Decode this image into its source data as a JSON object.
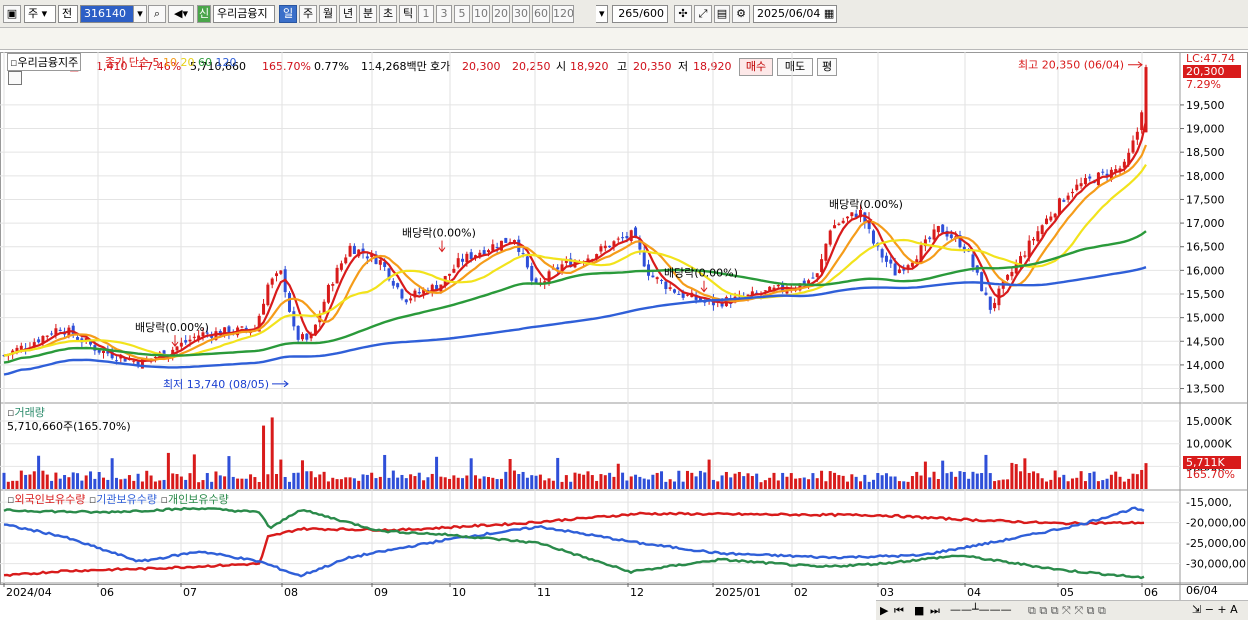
{
  "toolbar": {
    "period_type": "주",
    "compare_label": "전",
    "stock_code": "316140",
    "new_badge": "신",
    "stock_name": "우리금융지",
    "period_tabs": [
      "일",
      "주",
      "월",
      "년",
      "분",
      "초",
      "틱"
    ],
    "active_period": "일",
    "interval_buttons": [
      "1",
      "3",
      "5",
      "10",
      "20",
      "30",
      "60",
      "120"
    ],
    "count_value": "265",
    "count_max": "/600",
    "date_value": "2025/06/04"
  },
  "quote": {
    "price": "20,300",
    "change": "1,410",
    "change_pct": "+7.46%",
    "volume": "5,710,660",
    "volume_ratio": "165.70%",
    "turnover": "0.77%",
    "amount": "114,268백만",
    "hoga_label": "호가",
    "ask": "20,300",
    "bid": "20,250",
    "open_label": "시",
    "open": "18,920",
    "high_label": "고",
    "high": "20,350",
    "low_label": "저",
    "low": "18,920",
    "buy_label": "매수",
    "sell_label": "매도",
    "eval_label": "평"
  },
  "price_panel": {
    "title": "우리금융지주",
    "legend_prefix": "종가 단순",
    "ma_periods": [
      "5",
      "10",
      "20",
      "60",
      "120"
    ],
    "ma_colors": [
      "#d81b1b",
      "#f59c1a",
      "#f2e31c",
      "#2a9a3a",
      "#2f5fd8"
    ],
    "lc_label": "LC:47.74",
    "price_tag": "20,300",
    "pct_tag": "7.29%",
    "high_note": "최고 20,350 (06/04)",
    "low_note": "최저 13,740 (08/05)",
    "dividend_label": "배당락(0.00%)",
    "y_ticks": [
      "19,500",
      "19,000",
      "18,500",
      "18,000",
      "17,500",
      "17,000",
      "16,500",
      "16,000",
      "15,500",
      "15,000",
      "14,500",
      "14,000",
      "13,500"
    ]
  },
  "volume_panel": {
    "title": "거래량",
    "value_label": "5,710,660주(165.70%)",
    "y_ticks": [
      "15,000K",
      "10,000K",
      "5,000K"
    ],
    "tag_value": "5,711K",
    "tag_pct": "165.70%"
  },
  "holding_panel": {
    "series": [
      {
        "name": "외국인보유수량",
        "color": "#d81b1b"
      },
      {
        "name": "기관보유수량",
        "color": "#2f5fd8"
      },
      {
        "name": "개인보유수량",
        "color": "#2a8a4a"
      }
    ],
    "y_ticks": [
      "-15,000,",
      "-20,000,00",
      "-25,000,00",
      "-30,000,00"
    ]
  },
  "x_axis": {
    "labels": [
      "2024/04",
      "06",
      "07",
      "08",
      "09",
      "10",
      "11",
      "12",
      "2025/01",
      "02",
      "03",
      "04",
      "05",
      "06"
    ],
    "last_date": "06/04"
  },
  "chart_data": {
    "type": "candlestick",
    "title": "우리금융지주",
    "x": [
      "2024/04",
      "06",
      "07",
      "08",
      "09",
      "10",
      "11",
      "12",
      "2025/01",
      "02",
      "03",
      "04",
      "05",
      "06"
    ],
    "close_approx": [
      14300,
      14300,
      14600,
      15200,
      15900,
      16000,
      16200,
      16700,
      15700,
      15600,
      16300,
      15900,
      17600,
      20300
    ],
    "ylim": [
      13300,
      20450
    ],
    "high": {
      "value": 20350,
      "date": "06/04"
    },
    "low": {
      "value": 13740,
      "date": "08/05"
    }
  }
}
